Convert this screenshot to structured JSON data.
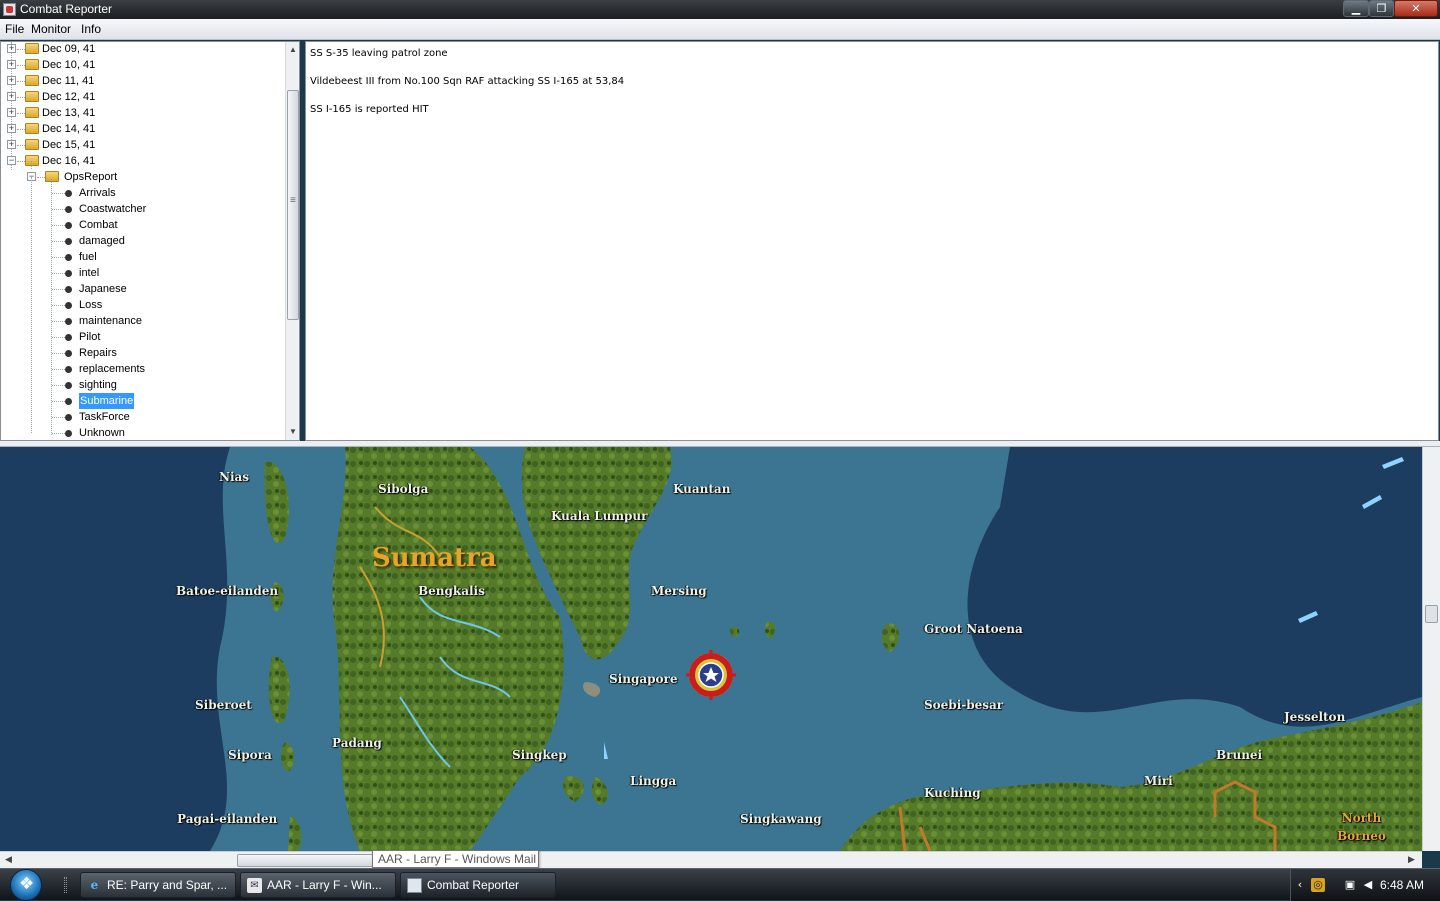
{
  "window": {
    "title": "Combat Reporter"
  },
  "menubar": {
    "file": "File",
    "monitor": "Monitor",
    "info": "Info"
  },
  "tree": {
    "dates": [
      "Dec 09, 41",
      "Dec 10, 41",
      "Dec 11, 41",
      "Dec 12, 41",
      "Dec 13, 41",
      "Dec 14, 41",
      "Dec 15, 41",
      "Dec 16, 41"
    ],
    "folder": "OpsReport",
    "reports": [
      "Arrivals",
      "Coastwatcher",
      "Combat",
      "damaged",
      "fuel",
      "intel",
      "Japanese",
      "Loss",
      "maintenance",
      "Pilot",
      "Repairs",
      "replacements",
      "sighting",
      "Submarine",
      "TaskForce",
      "Unknown"
    ],
    "selected": "Submarine"
  },
  "messages": [
    "SS S-35 leaving patrol zone",
    "Vildebeest III from No.100 Sqn RAF attacking SS I-165 at 53,84",
    "SS I-165 is reported HIT"
  ],
  "map": {
    "region_label": "Sumatra",
    "places": [
      "Nias",
      "Sibolga",
      "Kuala Lumpur",
      "Kuantan",
      "Batoe-eilanden",
      "Bengkalis",
      "Mersing",
      "Groot Natoena",
      "Singapore",
      "Siberoet",
      "Soebi-besar",
      "Jesselton",
      "Padang",
      "Sipora",
      "Singkep",
      "Brunei",
      "Lingga",
      "Miri",
      "Kuching",
      "Pagai-eilanden",
      "Singkawang"
    ],
    "north_borneo": [
      "North",
      "Borneo"
    ],
    "colors": {
      "sea": "#3c7592",
      "deep_sea": "#1d3d60",
      "land": "#5f7d2d",
      "marker": "#c91c1c"
    }
  },
  "tooltip": "AAR - Larry F - Windows Mail",
  "taskbar": {
    "tasks": [
      "RE: Parry and Spar, ...",
      "AAR - Larry F - Win...",
      "Combat Reporter"
    ],
    "clock": "6:48 AM"
  }
}
